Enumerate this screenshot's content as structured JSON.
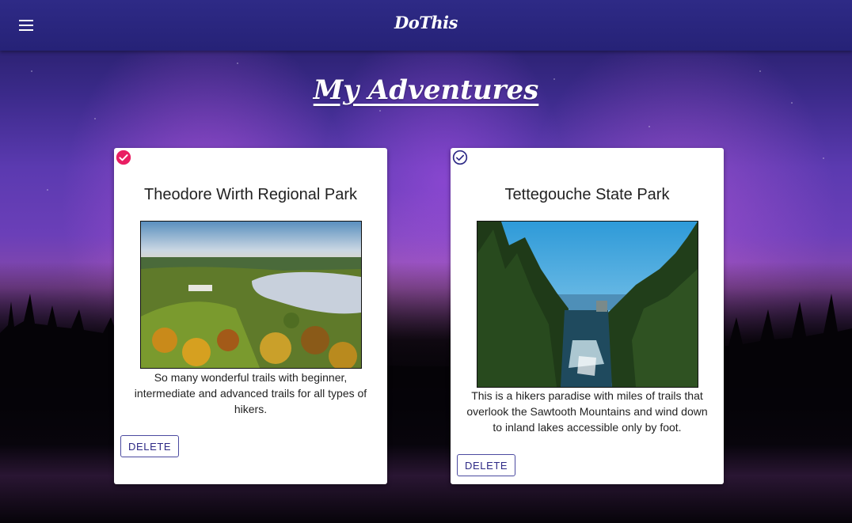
{
  "app": {
    "brand": "DoThis",
    "menu_icon": "menu-icon"
  },
  "page": {
    "title": "My Adventures"
  },
  "colors": {
    "appbar": "#2e2a86",
    "checked": "#e91e63",
    "unchecked": "#2e2a86",
    "button_text": "#2e2a86"
  },
  "cards": [
    {
      "title": "Theodore Wirth Regional Park",
      "description": "So many wonderful trails with beginner, intermediate and advanced trails for all types of hikers.",
      "completed": true,
      "status_icon": "check-circle-filled-icon",
      "delete_label": "DELETE"
    },
    {
      "title": "Tettegouche State Park",
      "description": "This is a hikers paradise with miles of trails that overlook the Sawtooth Mountains and wind down to inland lakes accessible only by foot.",
      "completed": false,
      "status_icon": "check-circle-outline-icon",
      "delete_label": "DELETE"
    }
  ]
}
